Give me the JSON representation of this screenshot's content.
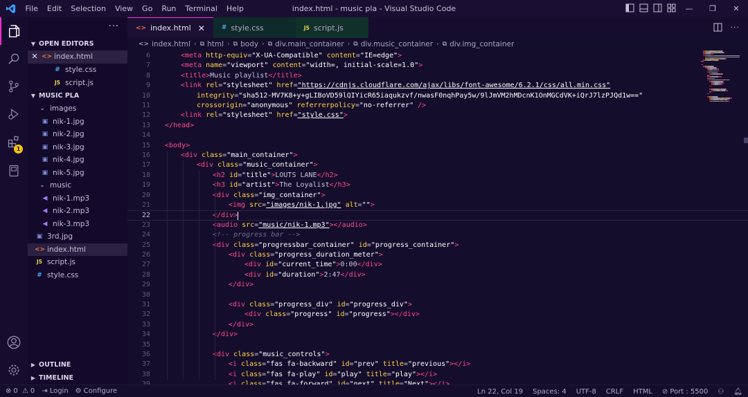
{
  "titlebar": {
    "menu": [
      "File",
      "Edit",
      "Selection",
      "View",
      "Go",
      "Run",
      "Terminal",
      "Help"
    ],
    "window_title": "index.html - music pla - Visual Studio Code",
    "minimize": "—",
    "restore": "❐",
    "close": "✕"
  },
  "activity": {
    "extensions_badge": "1"
  },
  "sidebar": {
    "more": "···",
    "open_editors": {
      "title": "OPEN EDITORS",
      "items": [
        {
          "name": "index.html",
          "type": "html",
          "close": "✕"
        },
        {
          "name": "style.css",
          "type": "css"
        },
        {
          "name": "script.js",
          "type": "js"
        }
      ]
    },
    "project": {
      "title": "MUSIC PLA",
      "items": [
        {
          "name": "images",
          "type": "folder"
        },
        {
          "name": "nik-1.jpg",
          "type": "img"
        },
        {
          "name": "nik-2.jpg",
          "type": "img"
        },
        {
          "name": "nik-3.jpg",
          "type": "img"
        },
        {
          "name": "nik-4.jpg",
          "type": "img"
        },
        {
          "name": "nik-5.jpg",
          "type": "img"
        },
        {
          "name": "music",
          "type": "folder"
        },
        {
          "name": "nik-1.mp3",
          "type": "mp3"
        },
        {
          "name": "nik-2.mp3",
          "type": "mp3"
        },
        {
          "name": "nik-3.mp3",
          "type": "mp3"
        },
        {
          "name": "3rd.jpg",
          "type": "img"
        },
        {
          "name": "index.html",
          "type": "html"
        },
        {
          "name": "script.js",
          "type": "js"
        },
        {
          "name": "style.css",
          "type": "css"
        }
      ]
    },
    "outline": "OUTLINE",
    "timeline": "TIMELINE"
  },
  "tabs": [
    {
      "label": "index.html",
      "type": "html",
      "close": "✕"
    },
    {
      "label": "style.css",
      "type": "css"
    },
    {
      "label": "script.js",
      "type": "js"
    }
  ],
  "breadcrumb": [
    "index.html",
    "html",
    "body",
    "div.main_container",
    "div.music_container",
    "div.img_container"
  ],
  "editor": {
    "current_line": "22",
    "lines": [
      {
        "n": "6",
        "indent": 1,
        "tokens": [
          [
            "tag",
            "<meta "
          ],
          [
            "attr",
            "http-equiv"
          ],
          [
            "punct",
            "="
          ],
          [
            "str",
            "\"X-UA-Compatible\""
          ],
          [
            "attr",
            " content"
          ],
          [
            "punct",
            "="
          ],
          [
            "str",
            "\"IE=edge\""
          ],
          [
            "tag",
            ">"
          ]
        ]
      },
      {
        "n": "7",
        "indent": 1,
        "tokens": [
          [
            "tag",
            "<meta "
          ],
          [
            "attr",
            "name"
          ],
          [
            "punct",
            "="
          ],
          [
            "str",
            "\"viewport\""
          ],
          [
            "attr",
            " content"
          ],
          [
            "punct",
            "="
          ],
          [
            "str",
            "\"width=, initial-scale=1.0\""
          ],
          [
            "tag",
            ">"
          ]
        ]
      },
      {
        "n": "8",
        "indent": 1,
        "tokens": [
          [
            "tag",
            "<title>"
          ],
          [
            "punct",
            "Music playlist"
          ],
          [
            "tag",
            "</title>"
          ]
        ]
      },
      {
        "n": "9",
        "indent": 1,
        "tokens": [
          [
            "tag",
            "<link "
          ],
          [
            "attr",
            "rel"
          ],
          [
            "punct",
            "="
          ],
          [
            "str",
            "\"stylesheet\""
          ],
          [
            "attr",
            " href"
          ],
          [
            "punct",
            "="
          ],
          [
            "url",
            "\"https://cdnjs.cloudflare.com/ajax/libs/font-awesome/6.2.1/css/all.min.css\""
          ]
        ]
      },
      {
        "n": "10",
        "indent": 2,
        "tokens": [
          [
            "attr",
            "integrity"
          ],
          [
            "punct",
            "="
          ],
          [
            "str",
            "\"sha512-MV7K8+y+gLIBoVD59lQIYicR65iaqukzvf/nwasF0nqhPay5w/9lJmVM2hMDcnK1OnMGCdVK+iQrJ7lzPJQd1w==\""
          ]
        ]
      },
      {
        "n": "11",
        "indent": 2,
        "tokens": [
          [
            "attr",
            "crossorigin"
          ],
          [
            "punct",
            "="
          ],
          [
            "str",
            "\"anonymous\""
          ],
          [
            "attr",
            " referrerpolicy"
          ],
          [
            "punct",
            "="
          ],
          [
            "str",
            "\"no-referrer\""
          ],
          [
            "tag",
            " />"
          ]
        ]
      },
      {
        "n": "12",
        "indent": 1,
        "tokens": [
          [
            "tag",
            "<link "
          ],
          [
            "attr",
            "rel"
          ],
          [
            "punct",
            "="
          ],
          [
            "str",
            "\"stylesheet\""
          ],
          [
            "attr",
            " href"
          ],
          [
            "punct",
            "="
          ],
          [
            "url",
            "\"style.css\""
          ],
          [
            "tag",
            ">"
          ]
        ]
      },
      {
        "n": "13",
        "indent": 0,
        "tokens": [
          [
            "tag",
            "</head>"
          ]
        ]
      },
      {
        "n": "14",
        "indent": 0,
        "tokens": []
      },
      {
        "n": "15",
        "indent": 0,
        "tokens": [
          [
            "tag",
            "<body>"
          ]
        ]
      },
      {
        "n": "16",
        "indent": 1,
        "tokens": [
          [
            "tag",
            "<div "
          ],
          [
            "attr",
            "class"
          ],
          [
            "punct",
            "="
          ],
          [
            "str",
            "\"main_container\""
          ],
          [
            "tag",
            ">"
          ]
        ]
      },
      {
        "n": "17",
        "indent": 2,
        "tokens": [
          [
            "tag",
            "<div "
          ],
          [
            "attr",
            "class"
          ],
          [
            "punct",
            "="
          ],
          [
            "str",
            "\"music_container\""
          ],
          [
            "tag",
            ">"
          ]
        ]
      },
      {
        "n": "18",
        "indent": 3,
        "tokens": [
          [
            "tag",
            "<h2 "
          ],
          [
            "attr",
            "id"
          ],
          [
            "punct",
            "="
          ],
          [
            "str",
            "\"title\""
          ],
          [
            "tag",
            ">"
          ],
          [
            "punct",
            "LOUTS LANE"
          ],
          [
            "tag",
            "</h2>"
          ]
        ]
      },
      {
        "n": "19",
        "indent": 3,
        "tokens": [
          [
            "tag",
            "<h3 "
          ],
          [
            "attr",
            "id"
          ],
          [
            "punct",
            "="
          ],
          [
            "str",
            "\"artist\""
          ],
          [
            "tag",
            ">"
          ],
          [
            "punct",
            "The Loyalist"
          ],
          [
            "tag",
            "</h3>"
          ]
        ]
      },
      {
        "n": "20",
        "indent": 3,
        "tokens": [
          [
            "tag",
            "<div "
          ],
          [
            "attr",
            "class"
          ],
          [
            "punct",
            "="
          ],
          [
            "str",
            "\"img_container\""
          ],
          [
            "tag",
            ">"
          ]
        ]
      },
      {
        "n": "21",
        "indent": 4,
        "tokens": [
          [
            "tag",
            "<img "
          ],
          [
            "attr",
            "src"
          ],
          [
            "punct",
            "="
          ],
          [
            "url",
            "\"images/nik-1.jpg\""
          ],
          [
            "attr",
            " alt"
          ],
          [
            "punct",
            "="
          ],
          [
            "str",
            "\"\""
          ],
          [
            "tag",
            ">"
          ]
        ]
      },
      {
        "n": "22",
        "indent": 3,
        "tokens": [
          [
            "tag",
            "</div>"
          ]
        ]
      },
      {
        "n": "23",
        "indent": 3,
        "tokens": [
          [
            "tag",
            "<audio "
          ],
          [
            "attr",
            "src"
          ],
          [
            "punct",
            "="
          ],
          [
            "url",
            "\"music/nik-1.mp3\""
          ],
          [
            "tag",
            "></audio>"
          ]
        ]
      },
      {
        "n": "24",
        "indent": 3,
        "tokens": [
          [
            "comment",
            "<!-- progress bar -->"
          ]
        ]
      },
      {
        "n": "25",
        "indent": 3,
        "tokens": [
          [
            "tag",
            "<div "
          ],
          [
            "attr",
            "class"
          ],
          [
            "punct",
            "="
          ],
          [
            "str",
            "\"progressbar_container\""
          ],
          [
            "attr",
            " id"
          ],
          [
            "punct",
            "="
          ],
          [
            "str",
            "\"progress_container\""
          ],
          [
            "tag",
            ">"
          ]
        ]
      },
      {
        "n": "26",
        "indent": 4,
        "tokens": [
          [
            "tag",
            "<div "
          ],
          [
            "attr",
            "class"
          ],
          [
            "punct",
            "="
          ],
          [
            "str",
            "\"progress_duration_meter\""
          ],
          [
            "tag",
            ">"
          ]
        ]
      },
      {
        "n": "27",
        "indent": 5,
        "tokens": [
          [
            "tag",
            "<div "
          ],
          [
            "attr",
            "id"
          ],
          [
            "punct",
            "="
          ],
          [
            "str",
            "\"current_time\""
          ],
          [
            "tag",
            ">"
          ],
          [
            "punct",
            "0:00"
          ],
          [
            "tag",
            "</div>"
          ]
        ]
      },
      {
        "n": "28",
        "indent": 5,
        "tokens": [
          [
            "tag",
            "<div "
          ],
          [
            "attr",
            "id"
          ],
          [
            "punct",
            "="
          ],
          [
            "str",
            "\"duration\""
          ],
          [
            "tag",
            ">"
          ],
          [
            "punct",
            "2:47"
          ],
          [
            "tag",
            "</div>"
          ]
        ]
      },
      {
        "n": "29",
        "indent": 4,
        "tokens": [
          [
            "tag",
            "</div>"
          ]
        ]
      },
      {
        "n": "30",
        "indent": 0,
        "tokens": []
      },
      {
        "n": "31",
        "indent": 4,
        "tokens": [
          [
            "tag",
            "<div "
          ],
          [
            "attr",
            "class"
          ],
          [
            "punct",
            "="
          ],
          [
            "str",
            "\"progress_div\""
          ],
          [
            "attr",
            " id"
          ],
          [
            "punct",
            "="
          ],
          [
            "str",
            "\"progress_div\""
          ],
          [
            "tag",
            ">"
          ]
        ]
      },
      {
        "n": "32",
        "indent": 5,
        "tokens": [
          [
            "tag",
            "<div "
          ],
          [
            "attr",
            "class"
          ],
          [
            "punct",
            "="
          ],
          [
            "str",
            "\"progress\""
          ],
          [
            "attr",
            " id"
          ],
          [
            "punct",
            "="
          ],
          [
            "str",
            "\"progress\""
          ],
          [
            "tag",
            "></div>"
          ]
        ]
      },
      {
        "n": "33",
        "indent": 4,
        "tokens": [
          [
            "tag",
            "</div>"
          ]
        ]
      },
      {
        "n": "34",
        "indent": 3,
        "tokens": [
          [
            "tag",
            "</div>"
          ]
        ]
      },
      {
        "n": "35",
        "indent": 0,
        "tokens": []
      },
      {
        "n": "36",
        "indent": 3,
        "tokens": [
          [
            "tag",
            "<div "
          ],
          [
            "attr",
            "class"
          ],
          [
            "punct",
            "="
          ],
          [
            "str",
            "\"music_controls\""
          ],
          [
            "tag",
            ">"
          ]
        ]
      },
      {
        "n": "37",
        "indent": 4,
        "tokens": [
          [
            "tag",
            "<i "
          ],
          [
            "attr",
            "class"
          ],
          [
            "punct",
            "="
          ],
          [
            "str",
            "\"fas fa-backward\""
          ],
          [
            "attr",
            " id"
          ],
          [
            "punct",
            "="
          ],
          [
            "str",
            "\"prev\""
          ],
          [
            "attr",
            " title"
          ],
          [
            "punct",
            "="
          ],
          [
            "str",
            "\"previous\""
          ],
          [
            "tag",
            "></i>"
          ]
        ]
      },
      {
        "n": "38",
        "indent": 4,
        "tokens": [
          [
            "tag",
            "<i "
          ],
          [
            "attr",
            "class"
          ],
          [
            "punct",
            "="
          ],
          [
            "str",
            "\"fas fa-play\""
          ],
          [
            "attr",
            " id"
          ],
          [
            "punct",
            "="
          ],
          [
            "str",
            "\"play\""
          ],
          [
            "attr",
            " title"
          ],
          [
            "punct",
            "="
          ],
          [
            "str",
            "\"play\""
          ],
          [
            "tag",
            "></i>"
          ]
        ]
      },
      {
        "n": "39",
        "indent": 4,
        "tokens": [
          [
            "tag",
            "<i "
          ],
          [
            "attr",
            "class"
          ],
          [
            "punct",
            "="
          ],
          [
            "str",
            "\"fas fa-forward\""
          ],
          [
            "attr",
            " id"
          ],
          [
            "punct",
            "="
          ],
          [
            "str",
            "\"next\""
          ],
          [
            "attr",
            " title"
          ],
          [
            "punct",
            "="
          ],
          [
            "str",
            "\"Next\""
          ],
          [
            "tag",
            "></i>"
          ]
        ]
      }
    ]
  },
  "statusbar": {
    "errors": "0",
    "warnings": "0",
    "login": "Login",
    "configure": "Configure",
    "position": "Ln 22, Col 19",
    "spaces": "Spaces: 4",
    "encoding": "UTF-8",
    "eol": "CRLF",
    "language": "HTML",
    "port": "Port : 5500"
  },
  "colors": {
    "accent": "#ff2ad0",
    "tag": "#ff4a8d",
    "attr": "#ffd54a",
    "string": "#ffffff",
    "background": "#150d2c"
  }
}
